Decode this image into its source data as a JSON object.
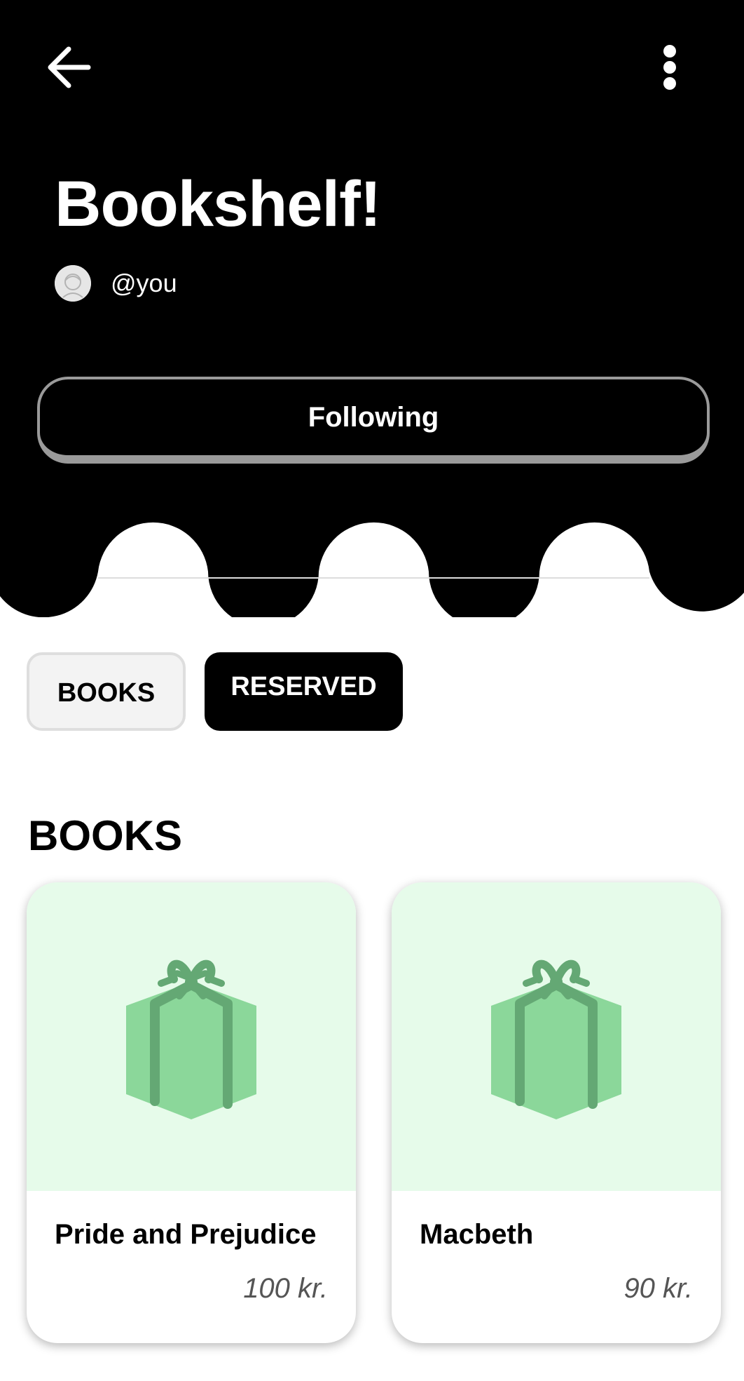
{
  "header": {
    "title": "Bookshelf!",
    "owner_handle": "@you",
    "follow_label": "Following",
    "back_icon": "arrow-left-icon",
    "menu_icon": "more-vertical-icon",
    "background_color": "#000000"
  },
  "tabs": [
    {
      "label": "BOOKS",
      "active": false
    },
    {
      "label": "RESERVED",
      "active": true
    }
  ],
  "section": {
    "title": "BOOKS"
  },
  "books": [
    {
      "title": "Pride and Prejudice",
      "price": "100 kr.",
      "icon": "gift-icon"
    },
    {
      "title": "Macbeth",
      "price": "90 kr.",
      "icon": "gift-icon"
    }
  ],
  "colors": {
    "card_image_bg": "#e6fbea",
    "gift_box": "#8bd79a",
    "gift_ribbon": "#64a874"
  }
}
